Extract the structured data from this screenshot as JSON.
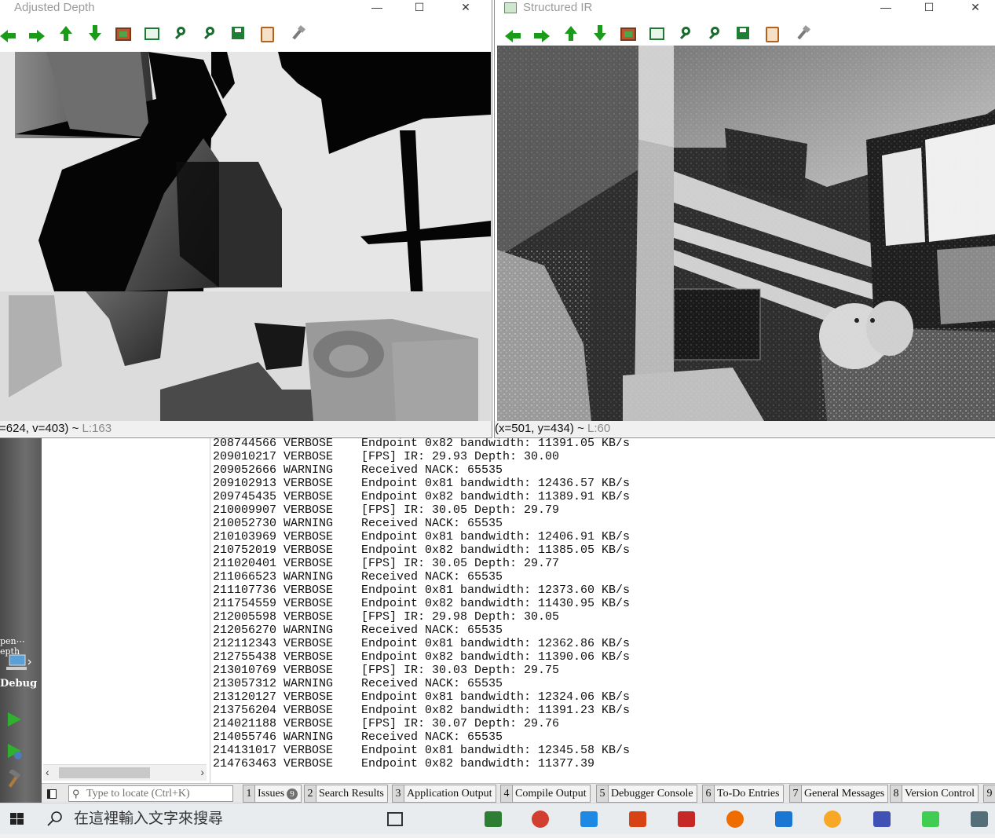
{
  "depth_window": {
    "title": "Adjusted Depth",
    "status_text": "=624, v=403) ~ ",
    "status_aux": "L:163"
  },
  "ir_window": {
    "title": "Structured IR",
    "status_text": "(x=501, y=434) ~ ",
    "status_aux": "L:60"
  },
  "toolbar_icons": [
    "pan-left-icon",
    "pan-right-icon",
    "pan-up-icon",
    "pan-down-icon",
    "zoom-to-fit-icon",
    "zoom-rect-icon",
    "zoom-in-icon",
    "zoom-out-icon",
    "save-icon",
    "copy-icon",
    "properties-icon"
  ],
  "sidebar": {
    "project_label": "pen⋯epth",
    "build_config": "Debug"
  },
  "log_rows": [
    {
      "ts": "208744566",
      "level": "VERBOSE",
      "msg": "Endpoint 0x82 bandwidth: 11391.05 KB/s"
    },
    {
      "ts": "209010217",
      "level": "VERBOSE",
      "msg": "[FPS] IR: 29.93 Depth: 30.00"
    },
    {
      "ts": "209052666",
      "level": "WARNING",
      "msg": "Received NACK: 65535"
    },
    {
      "ts": "209102913",
      "level": "VERBOSE",
      "msg": "Endpoint 0x81 bandwidth: 12436.57 KB/s"
    },
    {
      "ts": "209745435",
      "level": "VERBOSE",
      "msg": "Endpoint 0x82 bandwidth: 11389.91 KB/s"
    },
    {
      "ts": "210009907",
      "level": "VERBOSE",
      "msg": "[FPS] IR: 30.05 Depth: 29.79"
    },
    {
      "ts": "210052730",
      "level": "WARNING",
      "msg": "Received NACK: 65535"
    },
    {
      "ts": "210103969",
      "level": "VERBOSE",
      "msg": "Endpoint 0x81 bandwidth: 12406.91 KB/s"
    },
    {
      "ts": "210752019",
      "level": "VERBOSE",
      "msg": "Endpoint 0x82 bandwidth: 11385.05 KB/s"
    },
    {
      "ts": "211020401",
      "level": "VERBOSE",
      "msg": "[FPS] IR: 30.05 Depth: 29.77"
    },
    {
      "ts": "211066523",
      "level": "WARNING",
      "msg": "Received NACK: 65535"
    },
    {
      "ts": "211107736",
      "level": "VERBOSE",
      "msg": "Endpoint 0x81 bandwidth: 12373.60 KB/s"
    },
    {
      "ts": "211754559",
      "level": "VERBOSE",
      "msg": "Endpoint 0x82 bandwidth: 11430.95 KB/s"
    },
    {
      "ts": "212005598",
      "level": "VERBOSE",
      "msg": "[FPS] IR: 29.98 Depth: 30.05"
    },
    {
      "ts": "212056270",
      "level": "WARNING",
      "msg": "Received NACK: 65535"
    },
    {
      "ts": "212112343",
      "level": "VERBOSE",
      "msg": "Endpoint 0x81 bandwidth: 12362.86 KB/s"
    },
    {
      "ts": "212755438",
      "level": "VERBOSE",
      "msg": "Endpoint 0x82 bandwidth: 11390.06 KB/s"
    },
    {
      "ts": "213010769",
      "level": "VERBOSE",
      "msg": "[FPS] IR: 30.03 Depth: 29.75"
    },
    {
      "ts": "213057312",
      "level": "WARNING",
      "msg": "Received NACK: 65535"
    },
    {
      "ts": "213120127",
      "level": "VERBOSE",
      "msg": "Endpoint 0x81 bandwidth: 12324.06 KB/s"
    },
    {
      "ts": "213756204",
      "level": "VERBOSE",
      "msg": "Endpoint 0x82 bandwidth: 11391.23 KB/s"
    },
    {
      "ts": "214021188",
      "level": "VERBOSE",
      "msg": "[FPS] IR: 30.07 Depth: 29.76"
    },
    {
      "ts": "214055746",
      "level": "WARNING",
      "msg": "Received NACK: 65535"
    },
    {
      "ts": "214131017",
      "level": "VERBOSE",
      "msg": "Endpoint 0x81 bandwidth: 12345.58 KB/s"
    },
    {
      "ts": "214763463",
      "level": "VERBOSE",
      "msg": "Endpoint 0x82 bandwidth: 11377.39"
    }
  ],
  "output_bar": {
    "locator_placeholder": "Type to locate (Ctrl+K)",
    "tabs": [
      {
        "num": "1",
        "label": "Issues",
        "badge": "9"
      },
      {
        "num": "2",
        "label": "Search Results"
      },
      {
        "num": "3",
        "label": "Application Output"
      },
      {
        "num": "4",
        "label": "Compile Output"
      },
      {
        "num": "5",
        "label": "Debugger Console"
      },
      {
        "num": "6",
        "label": "To-Do Entries"
      },
      {
        "num": "7",
        "label": "General Messages"
      },
      {
        "num": "8",
        "label": "Version Control"
      },
      {
        "num": "9",
        "label": ""
      }
    ]
  },
  "taskbar": {
    "search_placeholder": "在這裡輸入文字來搜尋",
    "apps": [
      "task-view-icon",
      "store-icon",
      "chrome-icon",
      "mail-icon",
      "app-red-icon",
      "app-red2-icon",
      "firefox-icon",
      "vscode-icon",
      "chrome-canary-icon",
      "app-blue-icon",
      "qt-creator-icon",
      "terminal-icon"
    ]
  },
  "colors": {
    "toolbar_green": "#1a9b1a",
    "modebar": "#5a5a5a",
    "taskbar": "#e9ecef"
  }
}
